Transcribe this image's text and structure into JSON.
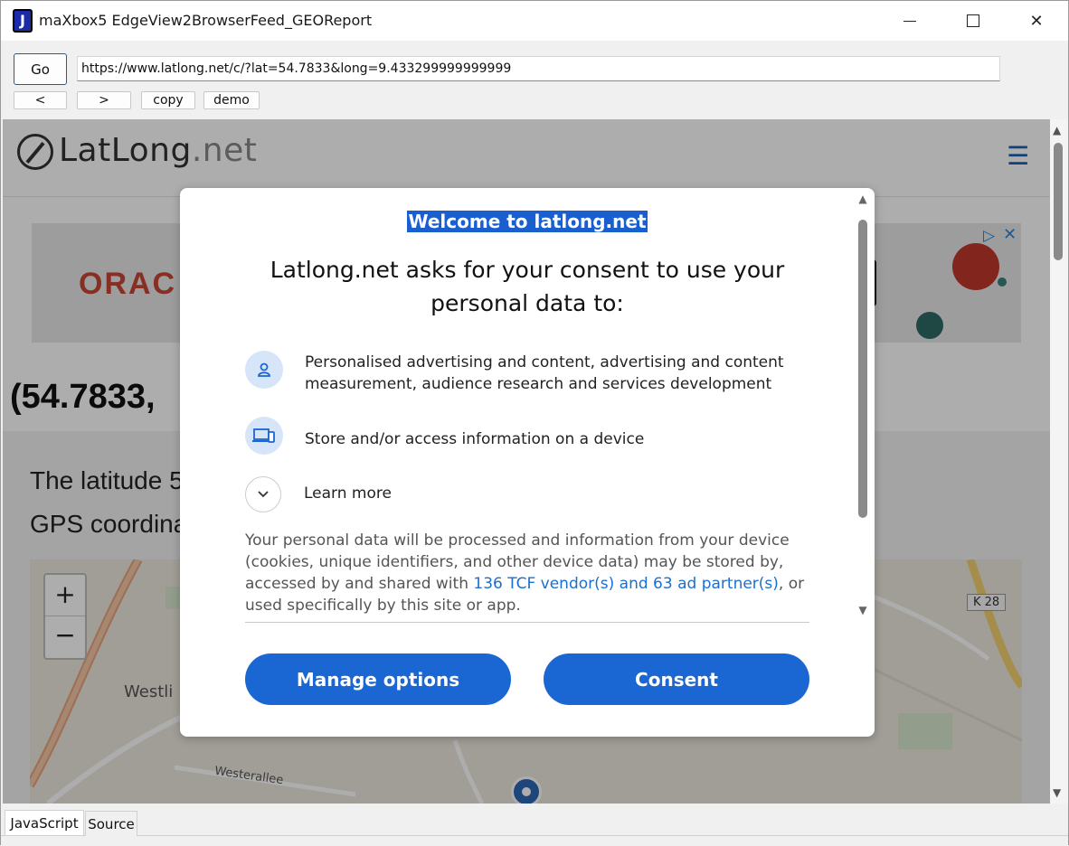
{
  "window": {
    "title": "maXbox5 EdgeView2BrowserFeed_GEOReport",
    "app_icon_letter": "J"
  },
  "toolbar": {
    "go_label": "Go",
    "url": "https://www.latlong.net/c/?lat=54.7833&long=9.433299999999999",
    "back_label": "<",
    "forward_label": ">",
    "copy_label": "copy",
    "demo_label": "demo"
  },
  "site": {
    "logo_main": "LatLong",
    "logo_suffix": ".net",
    "menu_glyph": "☰",
    "ad_text": "ORAC",
    "coords_heading": "(54.7833,",
    "para_line1": "The latitude 5",
    "para_line2": "GPS coordina",
    "map": {
      "zoom_in": "+",
      "zoom_out": "−",
      "label_west": "Westli",
      "label_westerallee": "Westerallee",
      "road_badge": "K 28"
    }
  },
  "consent": {
    "welcome": "Welcome to latlong.net",
    "heading": "Latlong.net asks for your consent to use your personal data to:",
    "purposes": [
      {
        "icon": "person-icon",
        "text": "Personalised advertising and content, advertising and content measurement, audience research and services development"
      },
      {
        "icon": "devices-icon",
        "text": "Store and/or access information on a device"
      }
    ],
    "learn_more": "Learn more",
    "disclosure_before": "Your personal data will be processed and information from your device (cookies, unique identifiers, and other device data) may be stored by, accessed by and shared with ",
    "disclosure_link": "136 TCF vendor(s) and 63 ad partner(s)",
    "disclosure_after": ", or used specifically by this site or app.",
    "manage_label": "Manage options",
    "consent_label": "Consent"
  },
  "bottom_tabs": [
    "JavaScript",
    "Source"
  ],
  "colors": {
    "accent_blue": "#1a66d2",
    "link_blue": "#1a6fd1",
    "selection_blue": "#1a5fd0"
  }
}
